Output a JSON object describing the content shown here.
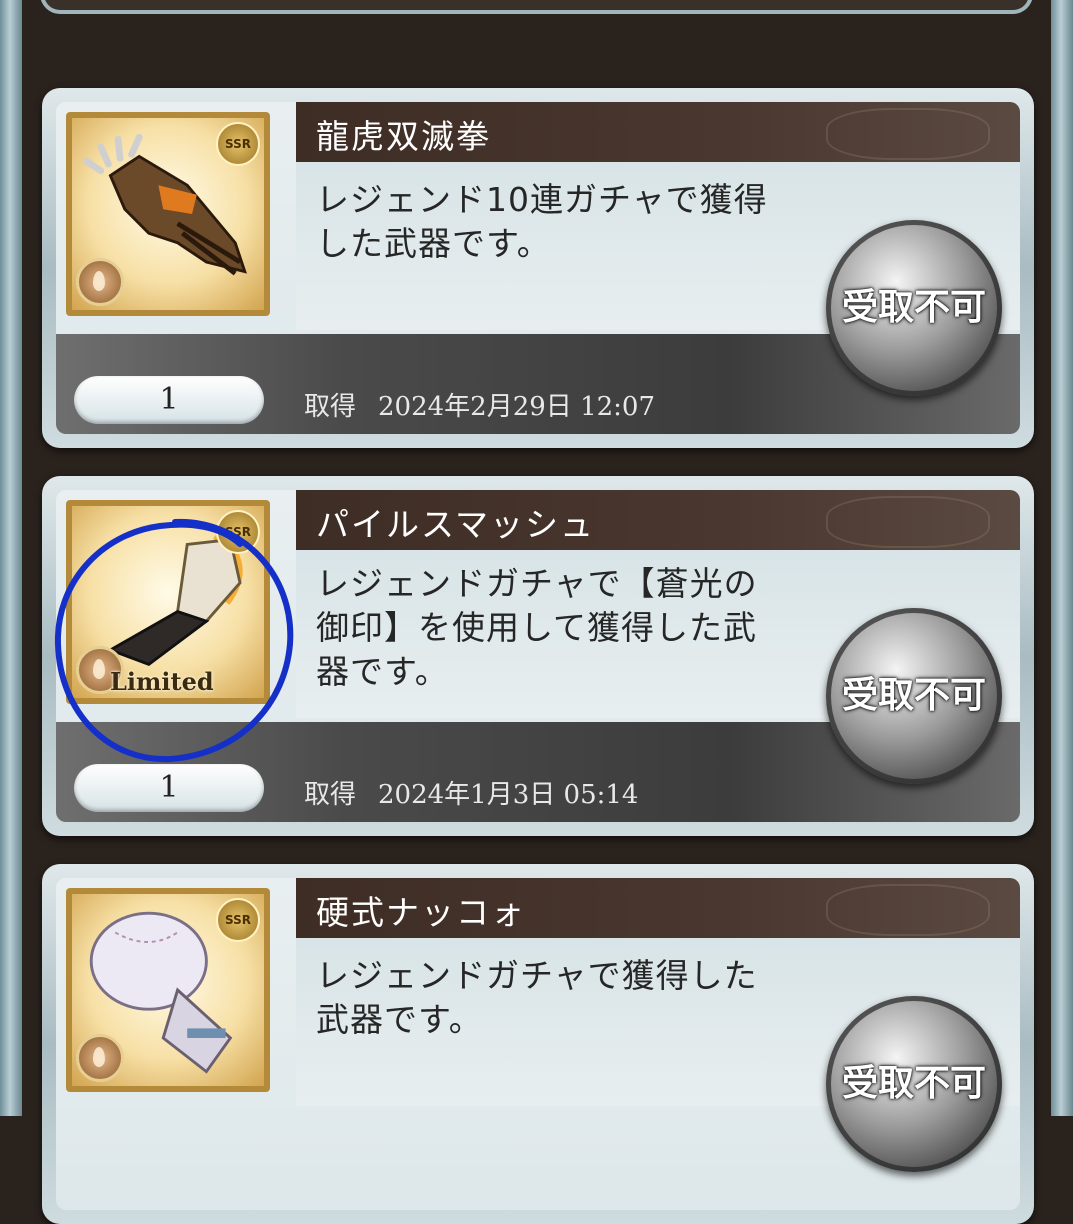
{
  "items": [
    {
      "name": "龍虎双滅拳",
      "description": [
        "レジェンド10連ガチャで獲得",
        "した武器です。"
      ],
      "rarity": "SSR",
      "limited": "",
      "count": "1",
      "acquired_label": "取得",
      "acquired_date": "2024年2月29日 12:07",
      "button_label": "受取不可",
      "icon": "claw-gauntlet-icon"
    },
    {
      "name": "パイルスマッシュ",
      "description": [
        "レジェンドガチャで【蒼光の",
        "御印】を使用して獲得した武",
        "器です。"
      ],
      "rarity": "SSR",
      "limited": "Limited",
      "count": "1",
      "acquired_label": "取得",
      "acquired_date": "2024年1月3日 05:14",
      "button_label": "受取不可",
      "icon": "pile-bunker-icon"
    },
    {
      "name": "硬式ナッコォ",
      "description": [
        "レジェンドガチャで獲得した",
        "武器です。"
      ],
      "rarity": "SSR",
      "limited": "",
      "count": "",
      "acquired_label": "",
      "acquired_date": "",
      "button_label": "受取不可",
      "icon": "baseball-glove-icon"
    }
  ],
  "colors": {
    "annotation": "#1530c8",
    "title_bar": "#3e2d25",
    "frame": "#b38a3a"
  }
}
